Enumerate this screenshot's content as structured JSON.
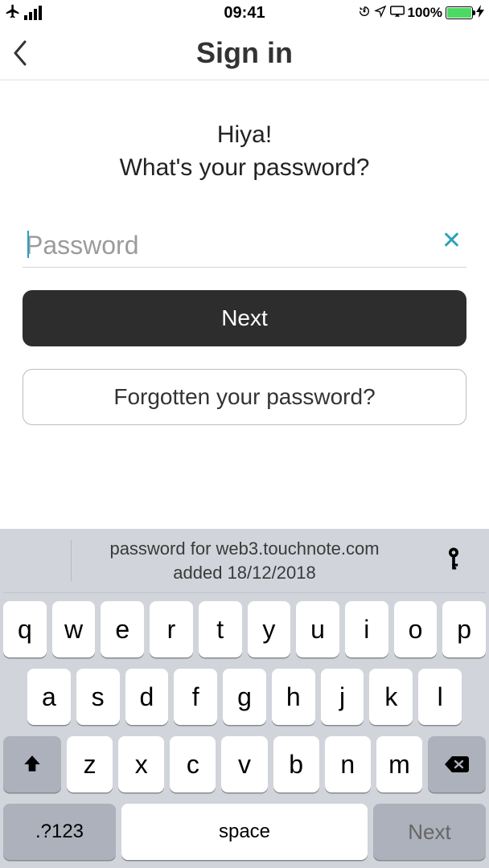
{
  "status": {
    "time": "09:41",
    "battery_pct": "100%"
  },
  "nav": {
    "title": "Sign in"
  },
  "content": {
    "greeting_line1": "Hiya!",
    "greeting_line2": "What's your password?",
    "password_placeholder": "Password",
    "next_label": "Next",
    "forgot_label": "Forgotten your password?"
  },
  "keyboard": {
    "suggestion_line1": "password for web3.touchnote.com",
    "suggestion_line2": "added 18/12/2018",
    "rows": {
      "r1": [
        "q",
        "w",
        "e",
        "r",
        "t",
        "y",
        "u",
        "i",
        "o",
        "p"
      ],
      "r2": [
        "a",
        "s",
        "d",
        "f",
        "g",
        "h",
        "j",
        "k",
        "l"
      ],
      "r3": [
        "z",
        "x",
        "c",
        "v",
        "b",
        "n",
        "m"
      ]
    },
    "sym_label": ".?123",
    "space_label": "space",
    "next_label": "Next"
  }
}
